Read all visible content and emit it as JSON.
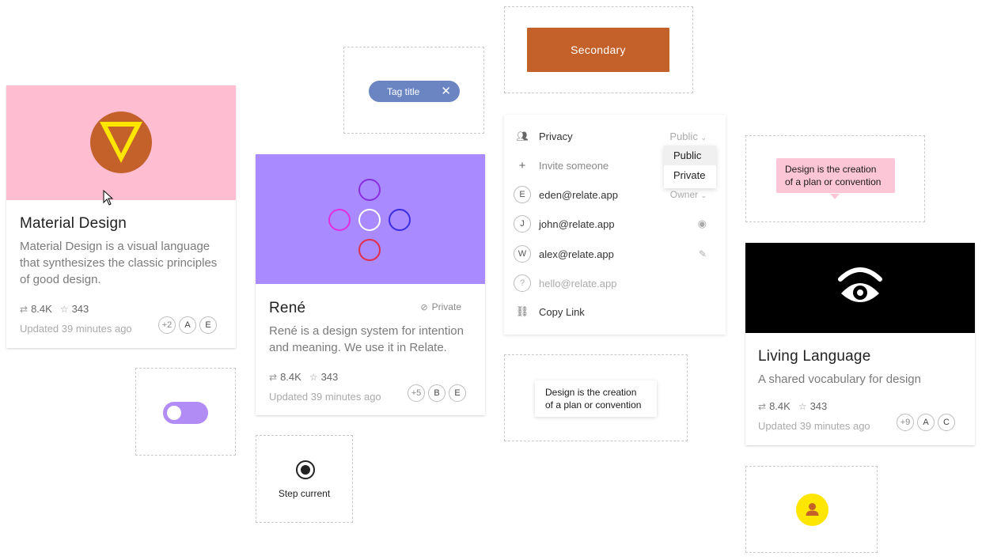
{
  "cards": {
    "material": {
      "title": "Material Design",
      "description": "Material Design is a visual language that synthesizes the classic principles of good design.",
      "forks": "8.4K",
      "stars": "343",
      "updated": "Updated 39 minutes ago",
      "avatars": [
        "+2",
        "A",
        "E"
      ],
      "media_color": "#ffbdd1",
      "logo_circle_color": "#c4602a",
      "logo_triangle_color": "#ffe600"
    },
    "rene": {
      "title": "René",
      "visibility": "Private",
      "description": "René is a design system for intention and meaning. We use it in Relate.",
      "forks": "8.4K",
      "stars": "343",
      "updated": "Updated 39 minutes ago",
      "avatars": [
        "+5",
        "B",
        "E"
      ],
      "media_color": "#a98aff"
    },
    "living": {
      "title": "Living Language",
      "description": "A shared vocabulary for design",
      "forks": "8.4K",
      "stars": "343",
      "updated": "Updated 39 minutes ago",
      "avatars": [
        "+9",
        "A",
        "C"
      ],
      "media_color": "#000000"
    }
  },
  "tag": {
    "label": "Tag title",
    "color": "#6a85c2"
  },
  "secondary_button": {
    "label": "Secondary",
    "color": "#c4602a"
  },
  "share_panel": {
    "privacy_label": "Privacy",
    "privacy_value": "Public",
    "dropdown_options": [
      "Public",
      "Private"
    ],
    "invite_placeholder": "Invite someone",
    "owner_value": "Owner",
    "members": [
      {
        "initial": "E",
        "email": "eden@relate.app"
      },
      {
        "initial": "J",
        "email": "john@relate.app"
      },
      {
        "initial": "W",
        "email": "alex@relate.app"
      },
      {
        "initial": "?",
        "email": "hello@relate.app"
      }
    ],
    "copy_link": "Copy Link"
  },
  "tooltips": {
    "pink": "Design is the creation of a plan or convention",
    "white": "Design is the creation of a plan or convention"
  },
  "toggle": {
    "on": true,
    "color": "#b18cf5"
  },
  "step": {
    "label": "Step current"
  },
  "avatar_badge": {
    "color": "#ffe600",
    "icon": "person-icon"
  }
}
